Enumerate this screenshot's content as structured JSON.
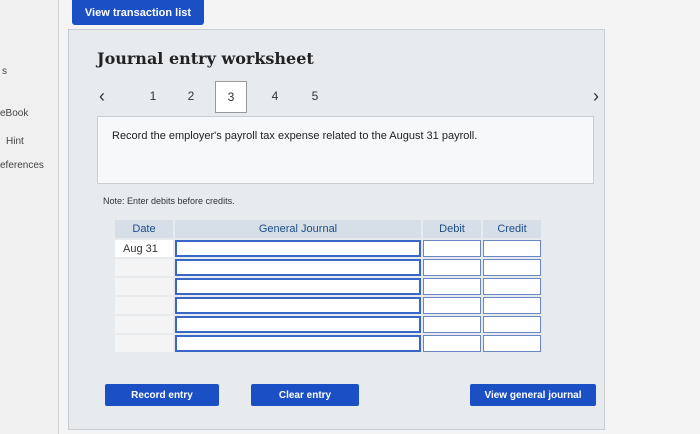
{
  "top_button": "View transaction list",
  "left_nav": [
    "s",
    "eBook",
    "Hint",
    "eferences"
  ],
  "worksheet": {
    "title": "Journal entry worksheet",
    "steps": [
      "1",
      "2",
      "3",
      "4",
      "5"
    ],
    "active_step": "3",
    "instruction": "Record the employer's payroll tax expense related to the August 31 payroll.",
    "note": "Note: Enter debits before credits."
  },
  "table": {
    "headers": [
      "Date",
      "General Journal",
      "Debit",
      "Credit"
    ],
    "rows": [
      {
        "date": "Aug 31"
      },
      {
        "date": ""
      },
      {
        "date": ""
      },
      {
        "date": ""
      },
      {
        "date": ""
      },
      {
        "date": ""
      }
    ]
  },
  "buttons": {
    "record": "Record entry",
    "clear": "Clear entry",
    "view_journal": "View general journal"
  },
  "colors": {
    "accent": "#1b4fc4",
    "header_text": "#1d4d86"
  }
}
